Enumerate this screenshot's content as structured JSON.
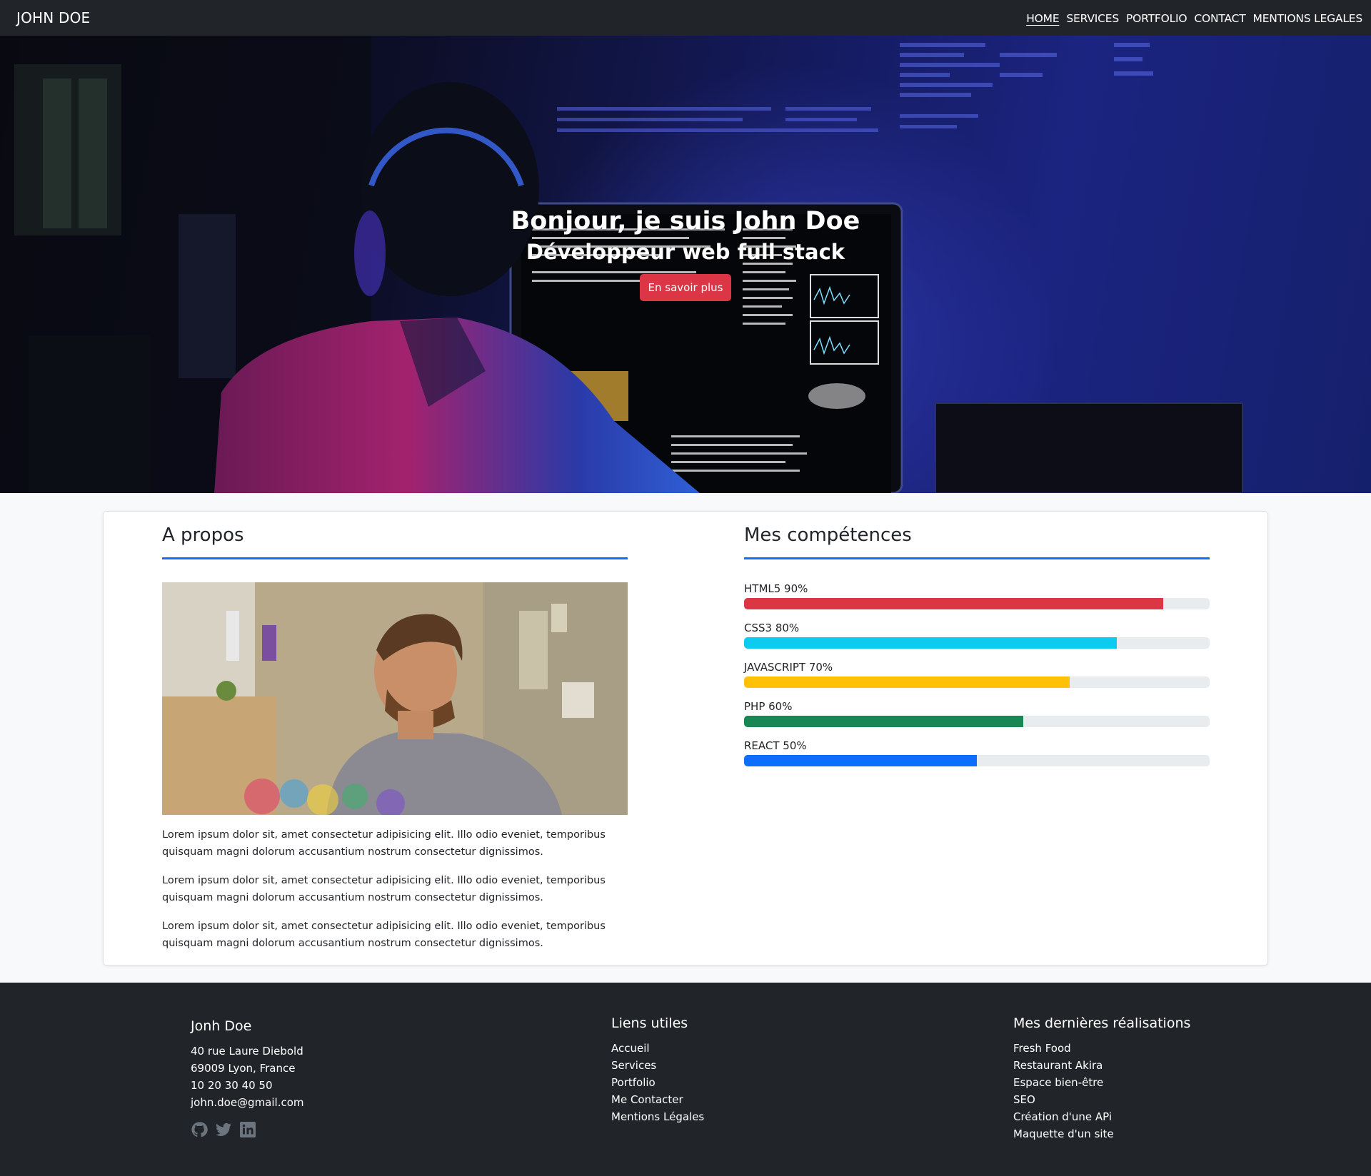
{
  "nav": {
    "brand": "JOHN DOE",
    "links": [
      "HOME",
      "SERVICES",
      "PORTFOLIO",
      "CONTACT",
      "MENTIONS LEGALES"
    ]
  },
  "hero": {
    "title": "Bonjour, je suis John Doe",
    "subtitle": "Développeur web full stack",
    "button": "En savoir plus"
  },
  "about": {
    "title": "A propos",
    "paragraphs": [
      "Lorem ipsum dolor sit, amet consectetur adipisicing elit. Illo odio eveniet, temporibus quisquam magni dolorum accusantium nostrum consectetur dignissimos.",
      "Lorem ipsum dolor sit, amet consectetur adipisicing elit. Illo odio eveniet, temporibus quisquam magni dolorum accusantium nostrum consectetur dignissimos.",
      "Lorem ipsum dolor sit, amet consectetur adipisicing elit. Illo odio eveniet, temporibus quisquam magni dolorum accusantium nostrum consectetur dignissimos."
    ]
  },
  "skills": {
    "title": "Mes compétences",
    "items": [
      {
        "label": "HTML5 90%",
        "level": 0.9,
        "color": "#dc3545"
      },
      {
        "label": "CSS3 80%",
        "level": 0.8,
        "color": "#0dcaf0"
      },
      {
        "label": "JAVASCRIPT 70%",
        "level": 0.7,
        "color": "#ffc107"
      },
      {
        "label": "PHP 60%",
        "level": 0.6,
        "color": "#198754"
      },
      {
        "label": "REACT 50%",
        "level": 0.5,
        "color": "#0d6efd"
      }
    ]
  },
  "footer": {
    "contact": {
      "title": "Jonh Doe",
      "address1": "40 rue Laure Diebold",
      "address2": "69009 Lyon, France",
      "phone": "10 20 30 40 50",
      "email": "john.doe@gmail.com",
      "socials": [
        "github-icon",
        "twitter-icon",
        "linkedin-icon"
      ]
    },
    "links": {
      "title": "Liens utiles",
      "items": [
        "Accueil",
        "Services",
        "Portfolio",
        "Me Contacter",
        "Mentions Légales"
      ]
    },
    "works": {
      "title": "Mes dernières réalisations",
      "items": [
        "Fresh Food",
        "Restaurant Akira",
        "Espace bien-être",
        "SEO",
        "Création d'une APi",
        "Maquette d'un site"
      ]
    }
  }
}
